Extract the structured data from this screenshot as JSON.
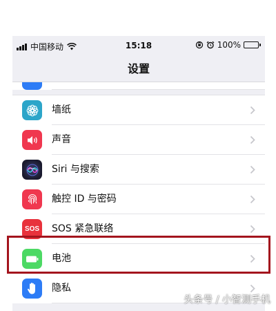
{
  "status_bar": {
    "carrier": "中国移动",
    "time": "15:18",
    "battery_percent": "100%"
  },
  "nav": {
    "title": "设置"
  },
  "colors": {
    "wallpaper": "#2ca5c9",
    "sounds": "#f0374f",
    "siri_dark": "#1a1a2e",
    "touchid": "#f0374f",
    "sos": "#e8323c",
    "battery": "#4cd964",
    "privacy": "#2d7cf6",
    "highlight": "#a3141d"
  },
  "settings": {
    "items": [
      {
        "label": "墙纸",
        "icon": "flower-icon"
      },
      {
        "label": "声音",
        "icon": "speaker-icon"
      },
      {
        "label": "Siri 与搜索",
        "icon": "siri-icon"
      },
      {
        "label": "触控 ID 与密码",
        "icon": "fingerprint-icon"
      },
      {
        "label": "SOS 紧急联络",
        "icon": "sos-icon",
        "icon_text": "SOS"
      },
      {
        "label": "电池",
        "icon": "battery-icon"
      },
      {
        "label": "隐私",
        "icon": "hand-icon"
      }
    ]
  },
  "watermark": "头条号 / 小智测手机"
}
